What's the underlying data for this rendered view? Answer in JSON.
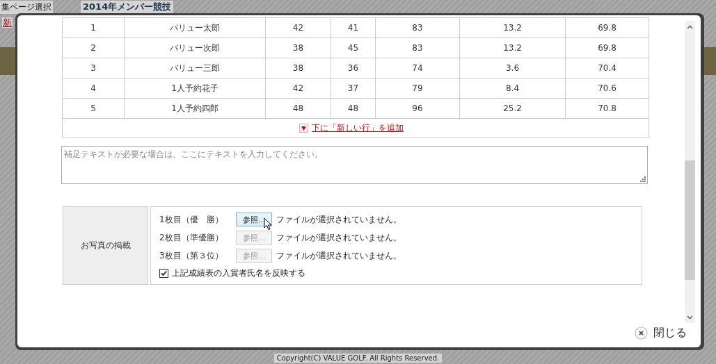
{
  "background_page": {
    "menu_label": "集ページ選択",
    "new_link": "新",
    "heading": "2014年メンバー競技",
    "copyright": "Copyright(C) VALUE GOLF. All Rights Reserved."
  },
  "results_table": {
    "rows": [
      {
        "cells": [
          "1",
          "バリュー太郎",
          "42",
          "41",
          "83",
          "13.2",
          "69.8"
        ]
      },
      {
        "cells": [
          "2",
          "バリュー次郎",
          "38",
          "45",
          "83",
          "13.2",
          "69.8"
        ]
      },
      {
        "cells": [
          "3",
          "バリュー三郎",
          "38",
          "36",
          "74",
          "3.6",
          "70.4"
        ]
      },
      {
        "cells": [
          "4",
          "1人予約花子",
          "42",
          "37",
          "79",
          "8.4",
          "70.6"
        ]
      },
      {
        "cells": [
          "5",
          "1人予約四郎",
          "48",
          "48",
          "96",
          "25.2",
          "70.8"
        ]
      }
    ],
    "add_row_link": "下に「新しい行」を追加"
  },
  "note": {
    "placeholder": "補足テキストが必要な場合は、ここにテキストを入力してください。"
  },
  "photos": {
    "label": "お写真の掲載",
    "files": [
      {
        "label": "1枚目（優　勝）",
        "button": "参照...",
        "status": "ファイルが選択されていません。",
        "disabled": false
      },
      {
        "label": "2枚目（準優勝）",
        "button": "参照...",
        "status": "ファイルが選択されていません。",
        "disabled": true
      },
      {
        "label": "3枚目（第３位）",
        "button": "参照...",
        "status": "ファイルが選択されていません。",
        "disabled": true
      }
    ],
    "reflect_names": {
      "label": "上記成績表の入賞者氏名を反映する",
      "checked": true
    }
  },
  "close_button": "閉じる"
}
